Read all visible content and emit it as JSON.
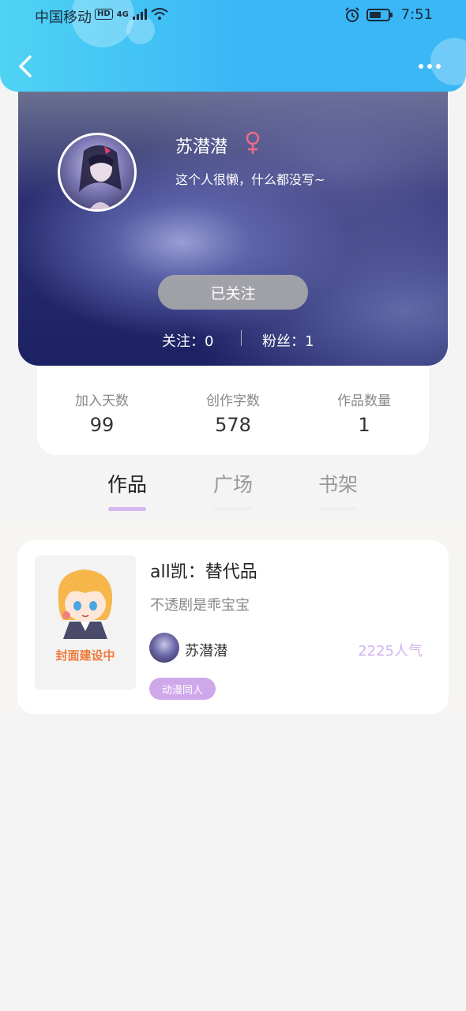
{
  "status_bar": {
    "carrier": "中国移动",
    "hd": "HD",
    "network": "4G",
    "time": "7:51"
  },
  "header": {
    "back_icon": "chevron-left-icon",
    "more_icon": "more-dots-icon"
  },
  "profile": {
    "name": "苏潜潜",
    "gender_symbol": "♀",
    "bio": "这个人很懒，什么都没写~",
    "follow_button": "已关注",
    "following_label": "关注：",
    "following_count": "0",
    "fans_label": "粉丝：",
    "fans_count": "1"
  },
  "stats": [
    {
      "label": "加入天数",
      "value": "99"
    },
    {
      "label": "创作字数",
      "value": "578"
    },
    {
      "label": "作品数量",
      "value": "1"
    }
  ],
  "tabs": [
    {
      "label": "作品",
      "active": true
    },
    {
      "label": "广场",
      "active": false
    },
    {
      "label": "书架",
      "active": false
    }
  ],
  "works": [
    {
      "cover_text": "封面建设中",
      "title": "all凯：替代品",
      "description": "不透剧是乖宝宝",
      "author": "苏潜潜",
      "popularity": "2225人气",
      "tag": "动漫同人"
    }
  ],
  "colors": {
    "header_gradient_start": "#4fd3f4",
    "header_gradient_end": "#38b6f6",
    "accent_purple": "#d7b8ec",
    "tag_purple": "#cfa8ea",
    "gender_pink": "#f06a8a"
  }
}
